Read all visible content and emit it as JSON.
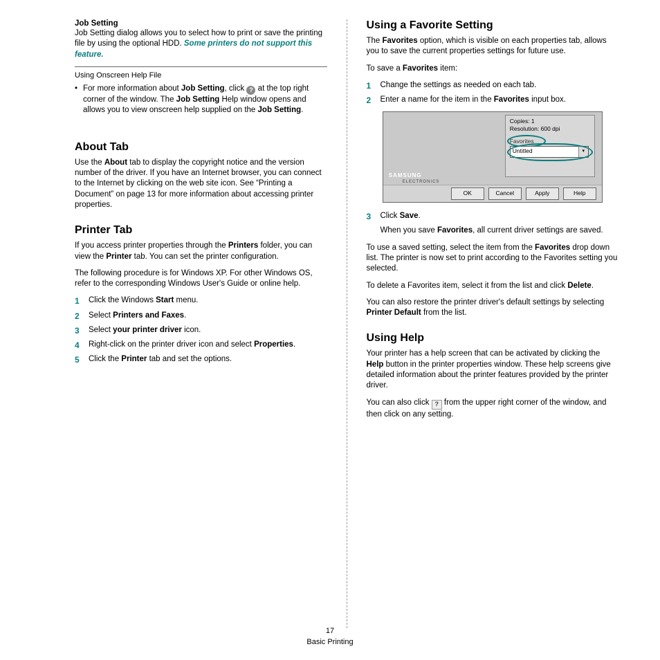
{
  "left": {
    "jobSetting": {
      "heading": "Job Setting",
      "body_pre": "Job Setting dialog allows you to select how to print or save the printing file by using the optional HDD. ",
      "body_em": "Some printers do not support this feature."
    },
    "onscreen": {
      "subhead": "Using Onscreen Help File",
      "bullet_pre": "For more information about  ",
      "bullet_b1": "Job Setting",
      "bullet_mid1": ", click ",
      "bullet_mid2": " at the top right corner of the window. The ",
      "bullet_b2": "Job Setting",
      "bullet_mid3": " Help window opens and allows you to view onscreen help supplied on the ",
      "bullet_b3": "Job Setting",
      "bullet_end": "."
    },
    "about": {
      "heading": "About Tab",
      "p_pre": "Use the ",
      "p_b": "About",
      "p_post": " tab to display the copyright notice and the version number of the driver. If you have an Internet browser, you can connect to the Internet by clicking on the web site icon. See “Printing a Document” on page 13 for more information about accessing printer properties."
    },
    "printer": {
      "heading": "Printer Tab",
      "p1_pre": "If you access printer properties through the ",
      "p1_b1": "Printers",
      "p1_mid": " folder, you can view the ",
      "p1_b2": "Printer",
      "p1_post": " tab. You can set the printer configuration.",
      "p2": "The following procedure is for Windows XP. For other Windows OS, refer to the corresponding Windows User's Guide or online help.",
      "steps": [
        {
          "num": "1",
          "pre": "Click the Windows ",
          "b": "Start",
          "post": " menu."
        },
        {
          "num": "2",
          "pre": "Select ",
          "b": "Printers and Faxes",
          "post": "."
        },
        {
          "num": "3",
          "pre": "Select ",
          "b": "your printer driver",
          "post": " icon."
        },
        {
          "num": "4",
          "pre": "Right-click on the printer driver icon and select ",
          "b": "Properties",
          "post": "."
        },
        {
          "num": "5",
          "pre": "Click the ",
          "b": "Printer",
          "post": " tab and set the options."
        }
      ]
    }
  },
  "right": {
    "fav": {
      "heading": "Using a Favorite Setting",
      "p1_pre": "The ",
      "p1_b": "Favorites",
      "p1_post": " option, which is visible on each properties tab, allows you to save the current properties settings for future use.",
      "p2_pre": "To save a ",
      "p2_b": "Favorites",
      "p2_post": " item:",
      "steps12": [
        {
          "num": "1",
          "txt": "Change the settings as needed on each tab."
        },
        {
          "num": "2",
          "pre": "Enter a name for the item in the ",
          "b": "Favorites",
          "post": " input box."
        }
      ],
      "mock": {
        "copies": "Copies: 1",
        "res": "Resolution: 600 dpi",
        "favlabel": "Favorites",
        "ddtext": "Untitled",
        "brand": "SAMSUNG",
        "brand2": "ELECTRONICS",
        "btn_ok": "OK",
        "btn_cancel": "Cancel",
        "btn_apply": "Apply",
        "btn_help": "Help"
      },
      "step3": {
        "num": "3",
        "pre": "Click ",
        "b": "Save",
        "post": "."
      },
      "step3_after_pre": "When you save ",
      "step3_after_b": "Favorites",
      "step3_after_post": ", all current driver settings are saved.",
      "p3_pre": "To use a saved setting, select the item from the ",
      "p3_b": "Favorites",
      "p3_post": " drop down list. The printer is now set to print according to the Favorites setting you selected.",
      "p4_pre": "To delete a Favorites item, select it from the list and click ",
      "p4_b": "Delete",
      "p4_post": ".",
      "p5_pre": "You can also restore the printer driver's default settings by selecting ",
      "p5_b": "Printer Default",
      "p5_post": " from the list."
    },
    "help": {
      "heading": "Using Help",
      "p1_pre": "Your printer has a help screen that can be activated by clicking the ",
      "p1_b": "Help",
      "p1_post": " button in the printer properties window. These help screens give detailed information about the printer features provided by the printer driver.",
      "p2_pre": "You can also click ",
      "p2_post": " from the upper right corner of the window, and then click on any setting."
    }
  },
  "footer": {
    "pagenum": "17",
    "section": "Basic Printing"
  }
}
